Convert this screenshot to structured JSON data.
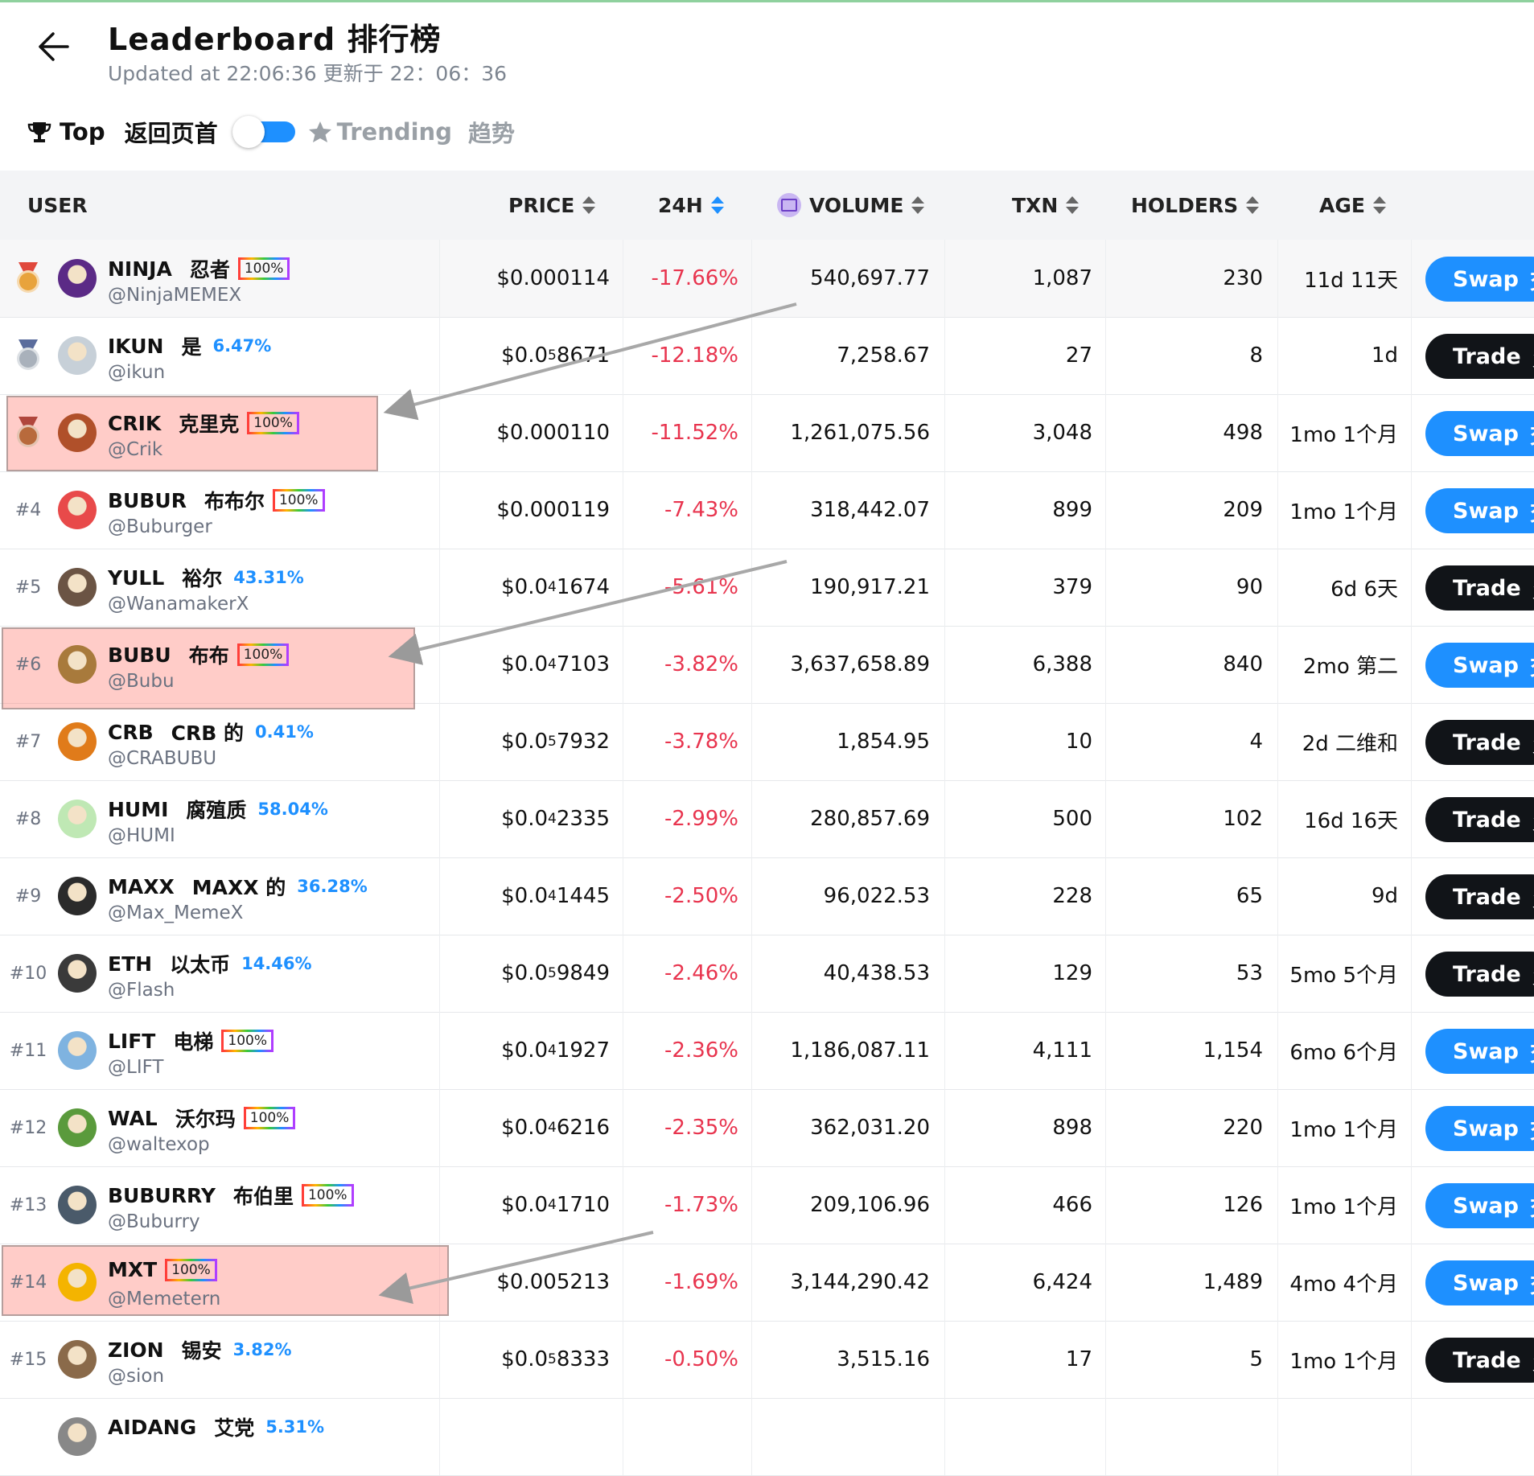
{
  "header": {
    "title": "Leaderboard  排行榜",
    "updated": "Updated at 22:06:36  更新于 22：06：36"
  },
  "tabs": {
    "top_label": "Top",
    "top_label_cn": "返回页首",
    "trending_label": "Trending",
    "trending_label_cn": "趋势",
    "toggle_on": true
  },
  "columns": {
    "user": "USER",
    "price": "PRICE",
    "change": "24H",
    "volume": "VOLUME",
    "txn": "TXN",
    "holders": "HOLDERS",
    "age": "AGE"
  },
  "colors": {
    "swap": "#1e90ff",
    "trade": "#111418",
    "negative": "#e8344e",
    "percent": "#1e90ff",
    "highlight": "#ffb3ad"
  },
  "rows": [
    {
      "rank": "",
      "medal": "gold",
      "symbol": "NINJA",
      "cn": "忍者",
      "badge": "100%",
      "pct": "",
      "handle": "@NinjaMEMEX",
      "price_a": "$0.000114",
      "price_sub": "",
      "price_b": "",
      "change": "-17.66%",
      "volume": "540,697.77",
      "txn": "1,087",
      "holders": "230",
      "age": "11d  11天",
      "action": "Swap",
      "action_cn": "交",
      "avatar_color": "#5b2a86",
      "highlight": false
    },
    {
      "rank": "",
      "medal": "silver",
      "symbol": "IKUN",
      "cn": "是",
      "badge": "",
      "pct": "6.47%",
      "handle": "@ikun",
      "price_a": "$0.0",
      "price_sub": "5",
      "price_b": "8671",
      "change": "-12.18%",
      "volume": "7,258.67",
      "txn": "27",
      "holders": "8",
      "age": "1d",
      "action": "Trade",
      "action_cn": "贸",
      "avatar_color": "#c7d0d8",
      "highlight": false
    },
    {
      "rank": "",
      "medal": "bronze",
      "symbol": "CRIK",
      "cn": "克里克",
      "badge": "100%",
      "pct": "",
      "handle": "@Crik",
      "price_a": "$0.000110",
      "price_sub": "",
      "price_b": "",
      "change": "-11.52%",
      "volume": "1,261,075.56",
      "txn": "3,048",
      "holders": "498",
      "age": "1mo  1个月",
      "action": "Swap",
      "action_cn": "交",
      "avatar_color": "#b0502a",
      "highlight": true
    },
    {
      "rank": "#4",
      "medal": "",
      "symbol": "BUBUR",
      "cn": "布布尔",
      "badge": "100%",
      "pct": "",
      "handle": "@Buburger",
      "price_a": "$0.000119",
      "price_sub": "",
      "price_b": "",
      "change": "-7.43%",
      "volume": "318,442.07",
      "txn": "899",
      "holders": "209",
      "age": "1mo  1个月",
      "action": "Swap",
      "action_cn": "交",
      "avatar_color": "#e84a4a",
      "highlight": false
    },
    {
      "rank": "#5",
      "medal": "",
      "symbol": "YULL",
      "cn": "裕尔",
      "badge": "",
      "pct": "43.31%",
      "handle": "@WanamakerX",
      "price_a": "$0.0",
      "price_sub": "4",
      "price_b": "1674",
      "change": "-5.61%",
      "volume": "190,917.21",
      "txn": "379",
      "holders": "90",
      "age": "6d  6天",
      "action": "Trade",
      "action_cn": "贸",
      "avatar_color": "#6b5444",
      "highlight": false
    },
    {
      "rank": "#6",
      "medal": "",
      "symbol": "BUBU",
      "cn": "布布",
      "badge": "100%",
      "pct": "",
      "handle": "@Bubu",
      "price_a": "$0.0",
      "price_sub": "4",
      "price_b": "7103",
      "change": "-3.82%",
      "volume": "3,637,658.89",
      "txn": "6,388",
      "holders": "840",
      "age": "2mo  第二",
      "action": "Swap",
      "action_cn": "交",
      "avatar_color": "#a87a3c",
      "highlight": true
    },
    {
      "rank": "#7",
      "medal": "",
      "symbol": "CRB",
      "cn": "CRB 的",
      "badge": "",
      "pct": "0.41%",
      "handle": "@CRABUBU",
      "price_a": "$0.0",
      "price_sub": "5",
      "price_b": "7932",
      "change": "-3.78%",
      "volume": "1,854.95",
      "txn": "10",
      "holders": "4",
      "age": "2d  二维和",
      "action": "Trade",
      "action_cn": "贸",
      "avatar_color": "#e07b1a",
      "highlight": false
    },
    {
      "rank": "#8",
      "medal": "",
      "symbol": "HUMI",
      "cn": "腐殖质",
      "badge": "",
      "pct": "58.04%",
      "handle": "@HUMI",
      "price_a": "$0.0",
      "price_sub": "4",
      "price_b": "2335",
      "change": "-2.99%",
      "volume": "280,857.69",
      "txn": "500",
      "holders": "102",
      "age": "16d  16天",
      "action": "Trade",
      "action_cn": "贸",
      "avatar_color": "#bfe8b4",
      "highlight": false
    },
    {
      "rank": "#9",
      "medal": "",
      "symbol": "MAXX",
      "cn": "MAXX 的",
      "badge": "",
      "pct": "36.28%",
      "handle": "@Max_MemeX",
      "price_a": "$0.0",
      "price_sub": "4",
      "price_b": "1445",
      "change": "-2.50%",
      "volume": "96,022.53",
      "txn": "228",
      "holders": "65",
      "age": "9d",
      "action": "Trade",
      "action_cn": "贸",
      "avatar_color": "#2b2b2b",
      "highlight": false
    },
    {
      "rank": "#10",
      "medal": "",
      "symbol": "ETH",
      "cn": "以太币",
      "badge": "",
      "pct": "14.46%",
      "handle": "@Flash",
      "price_a": "$0.0",
      "price_sub": "5",
      "price_b": "9849",
      "change": "-2.46%",
      "volume": "40,438.53",
      "txn": "129",
      "holders": "53",
      "age": "5mo  5个月",
      "action": "Trade",
      "action_cn": "贸",
      "avatar_color": "#3a3a3a",
      "highlight": false
    },
    {
      "rank": "#11",
      "medal": "",
      "symbol": "LIFT",
      "cn": "电梯",
      "badge": "100%",
      "pct": "",
      "handle": "@LIFT",
      "price_a": "$0.0",
      "price_sub": "4",
      "price_b": "1927",
      "change": "-2.36%",
      "volume": "1,186,087.11",
      "txn": "4,111",
      "holders": "1,154",
      "age": "6mo  6个月",
      "action": "Swap",
      "action_cn": "交",
      "avatar_color": "#7fb3e0",
      "highlight": false
    },
    {
      "rank": "#12",
      "medal": "",
      "symbol": "WAL",
      "cn": "沃尔玛",
      "badge": "100%",
      "pct": "",
      "handle": "@waltexop",
      "price_a": "$0.0",
      "price_sub": "4",
      "price_b": "6216",
      "change": "-2.35%",
      "volume": "362,031.20",
      "txn": "898",
      "holders": "220",
      "age": "1mo  1个月",
      "action": "Swap",
      "action_cn": "交",
      "avatar_color": "#5a9a3c",
      "highlight": false
    },
    {
      "rank": "#13",
      "medal": "",
      "symbol": "BUBURRY",
      "cn": "布伯里",
      "badge": "100%",
      "pct": "",
      "handle": "@Buburry",
      "price_a": "$0.0",
      "price_sub": "4",
      "price_b": "1710",
      "change": "-1.73%",
      "volume": "209,106.96",
      "txn": "466",
      "holders": "126",
      "age": "1mo  1个月",
      "action": "Swap",
      "action_cn": "交",
      "avatar_color": "#4a5a6a",
      "highlight": false
    },
    {
      "rank": "#14",
      "medal": "",
      "symbol": "MXT",
      "cn": "",
      "badge": "100%",
      "pct": "",
      "handle": "@Memetern",
      "price_a": "$0.005213",
      "price_sub": "",
      "price_b": "",
      "change": "-1.69%",
      "volume": "3,144,290.42",
      "txn": "6,424",
      "holders": "1,489",
      "age": "4mo  4个月",
      "action": "Swap",
      "action_cn": "交",
      "avatar_color": "#f4b400",
      "highlight": true
    },
    {
      "rank": "#15",
      "medal": "",
      "symbol": "ZION",
      "cn": "锡安",
      "badge": "",
      "pct": "3.82%",
      "handle": "@sion",
      "price_a": "$0.0",
      "price_sub": "5",
      "price_b": "8333",
      "change": "-0.50%",
      "volume": "3,515.16",
      "txn": "17",
      "holders": "5",
      "age": "1mo  1个月",
      "action": "Trade",
      "action_cn": "贸",
      "avatar_color": "#8a6a4a",
      "highlight": false
    },
    {
      "rank": "",
      "medal": "",
      "symbol": "AIDANG",
      "cn": "艾党",
      "badge": "",
      "pct": "5.31%",
      "handle": "",
      "price_a": "",
      "price_sub": "",
      "price_b": "",
      "change": "",
      "volume": "",
      "txn": "",
      "holders": "",
      "age": "",
      "action": "",
      "action_cn": "",
      "avatar_color": "#888888",
      "highlight": false
    }
  ]
}
